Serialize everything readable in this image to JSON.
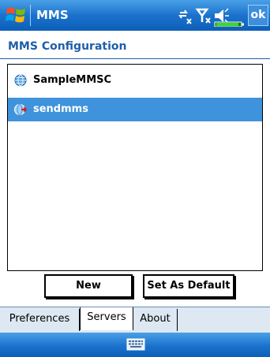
{
  "titlebar": {
    "app_title": "MMS",
    "ok_label": "ok",
    "icons": [
      "windows-start-icon",
      "connectivity-icon",
      "signal-icon",
      "speaker-icon",
      "battery-icon"
    ]
  },
  "page": {
    "title": "MMS Configuration"
  },
  "server_list": {
    "items": [
      {
        "label": "SampleMMSC",
        "icon": "globe-icon",
        "selected": false
      },
      {
        "label": "sendmms",
        "icon": "globe-active-icon",
        "selected": true
      }
    ]
  },
  "buttons": {
    "new_label": "New",
    "set_default_label": "Set As Default"
  },
  "tabs": [
    {
      "label": "Preferences",
      "active": false
    },
    {
      "label": "Servers",
      "active": true
    },
    {
      "label": "About",
      "active": false
    }
  ],
  "softkeys": {
    "icon": "keyboard-icon"
  },
  "colors": {
    "title_blue": "#1f5fa8",
    "selection_blue": "#3f93dc",
    "bar_blue": "#1b72cc",
    "tab_bg": "#dde8f3"
  }
}
